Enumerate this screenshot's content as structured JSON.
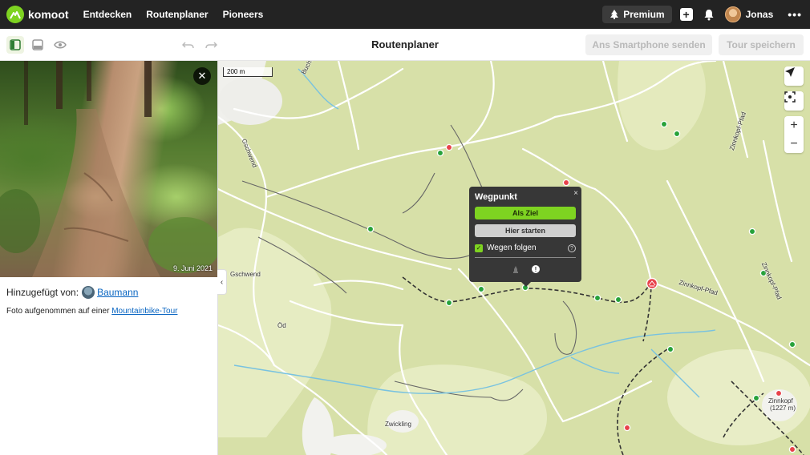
{
  "app": {
    "brand": "komoot",
    "nav": [
      "Entdecken",
      "Routenplaner",
      "Pioneers"
    ],
    "premium_label": "Premium",
    "user_name": "Jonas",
    "more_label": "•••"
  },
  "toolbar": {
    "title": "Routenplaner",
    "send_label": "Ans Smartphone senden",
    "save_label": "Tour speichern"
  },
  "photo_panel": {
    "date": "9. Juni 2021",
    "close_label": "✕",
    "added_by_label": "Hinzugefügt von:",
    "added_by_user": "Baumann",
    "caption_prefix": "Foto aufgenommen auf einer ",
    "caption_link": "Mountainbike-Tour",
    "collapse_label": "‹"
  },
  "map": {
    "scale_label": "200 m",
    "labels": {
      "buchecker_weg": "Buchecker Weg",
      "gschwend_road": "Gschwend",
      "gschwend_town": "Gschwend",
      "od": "Öd",
      "zwickling": "Zwickling",
      "zinnkopf_pfad_top": "Zinnkopf-Pfad",
      "zinnkopf_pfad_mid": "Zinnkopf-Pfad",
      "zinnkopf_pfad_right": "Zinnkopf-Pfad",
      "zinnkopf_peak": "Zinnkopf",
      "zinnkopf_elev": "(1227 m)"
    },
    "zoom_in": "+",
    "zoom_out": "−",
    "colors": {
      "background": "#d7e0a8",
      "forest_light": "#e8edc6",
      "path": "#555555",
      "road": "#ffffff",
      "water": "#78c2e0",
      "waypoint": "#27a23a",
      "poi": "#e8424a"
    }
  },
  "popup": {
    "title": "Wegpunkt",
    "close_label": "×",
    "set_destination": "Als Ziel",
    "start_here": "Hier starten",
    "follow_paths_label": "Wegen folgen",
    "follow_paths_checked": true,
    "help_label": "?",
    "info_label": "!"
  }
}
